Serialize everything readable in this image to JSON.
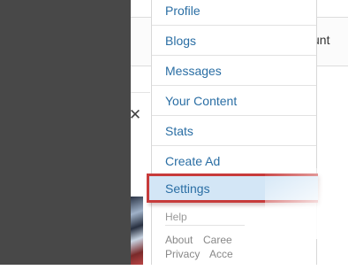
{
  "header": {
    "account_text": "unt"
  },
  "ad_close": {
    "icon": "close-icon",
    "glyph": "✕"
  },
  "menu": {
    "items": [
      {
        "label": "Profile"
      },
      {
        "label": "Blogs"
      },
      {
        "label": "Messages"
      },
      {
        "label": "Your Content"
      },
      {
        "label": "Stats"
      },
      {
        "label": "Create Ad"
      },
      {
        "label": "Settings"
      }
    ],
    "help_label": "Help",
    "footer_links": [
      "About",
      "Caree",
      "Privacy",
      "Acce"
    ]
  },
  "colors": {
    "menu_link": "#2a6ea4",
    "selected_bg": "#d3e6f6",
    "highlight_border": "#c73b3b",
    "left_panel": "#484848"
  }
}
